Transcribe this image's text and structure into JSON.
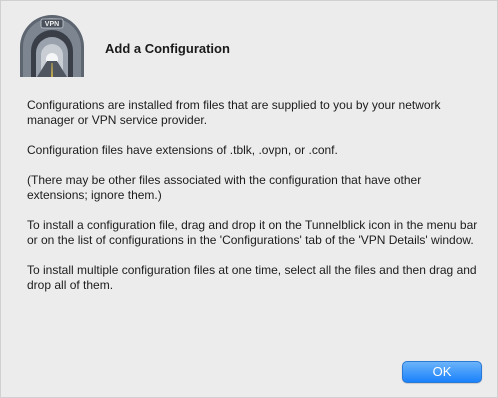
{
  "dialog": {
    "title": "Add a Configuration",
    "icon": {
      "name": "tunnelblick-vpn-icon",
      "label": "VPN"
    },
    "paragraphs": [
      "Configurations are installed from files that are supplied to you by your network manager or VPN service provider.",
      "Configuration files have extensions of .tblk, .ovpn, or .conf.",
      "(There may be other files associated with the configuration that have other extensions; ignore them.)",
      "To install a configuration file, drag and drop it on the Tunnelblick icon in the menu bar or on the list of configurations in the 'Configurations' tab of the 'VPN Details' window.",
      "To install multiple configuration files at one time, select all the files and then drag and drop all of them."
    ],
    "ok_label": "OK"
  },
  "colors": {
    "background": "#ececec",
    "button_accent": "#1a82fb"
  }
}
